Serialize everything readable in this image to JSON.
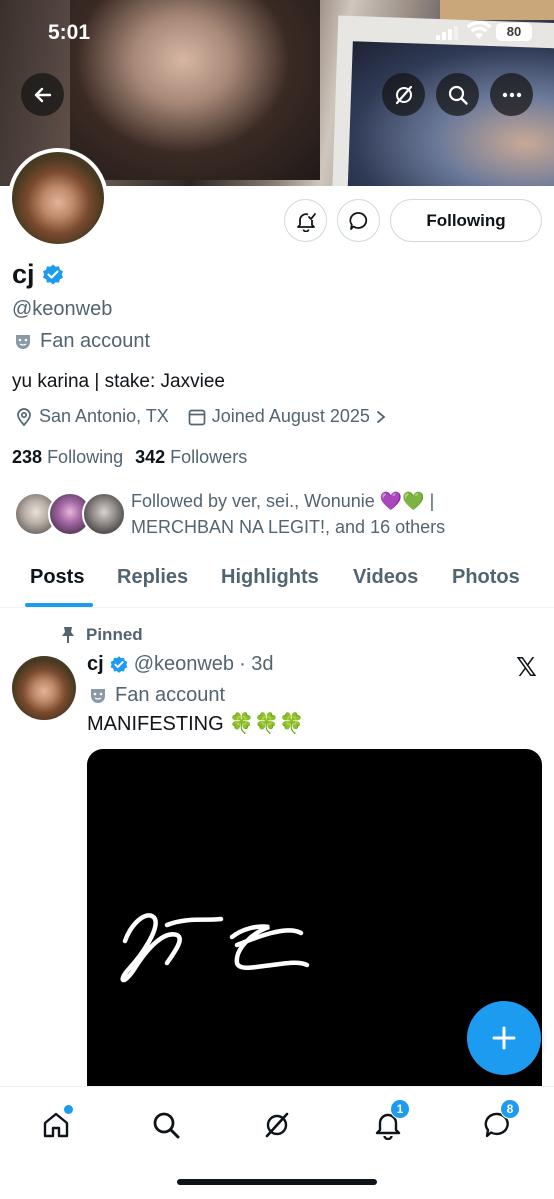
{
  "status_bar": {
    "time": "5:01",
    "battery": "80"
  },
  "header": {
    "back_icon": "arrow-left-icon",
    "grok_icon": "grok-icon",
    "search_icon": "search-icon",
    "more_icon": "more-horizontal-icon"
  },
  "profile": {
    "name": "cj",
    "handle": "@keonweb",
    "category": "Fan account",
    "bio": "yu karina | stake: Jaxviee",
    "location": "San Antonio, TX",
    "joined": "Joined August 2025",
    "following_count": "238",
    "following_label": "Following",
    "followers_count": "342",
    "followers_label": "Followers",
    "followed_by": "Followed by ver, sei., Wonunie 💜💚 | MERCHBAN NA LEGIT!, and 16 others",
    "follow_button_label": "Following",
    "verified_color": "#1d9bf0"
  },
  "tabs": [
    {
      "label": "Posts",
      "active": true
    },
    {
      "label": "Replies"
    },
    {
      "label": "Highlights"
    },
    {
      "label": "Videos"
    },
    {
      "label": "Photos"
    }
  ],
  "pinned_post": {
    "pinned_label": "Pinned",
    "name": "cj",
    "handle": "@keonweb",
    "time": "· 3d",
    "category": "Fan account",
    "text": "MANIFESTING 🍀🍀🍀"
  },
  "bottom_nav": {
    "notifications_badge": "1",
    "messages_badge": "8"
  },
  "colors": {
    "accent": "#1d9bf0",
    "text_secondary": "#536471"
  }
}
